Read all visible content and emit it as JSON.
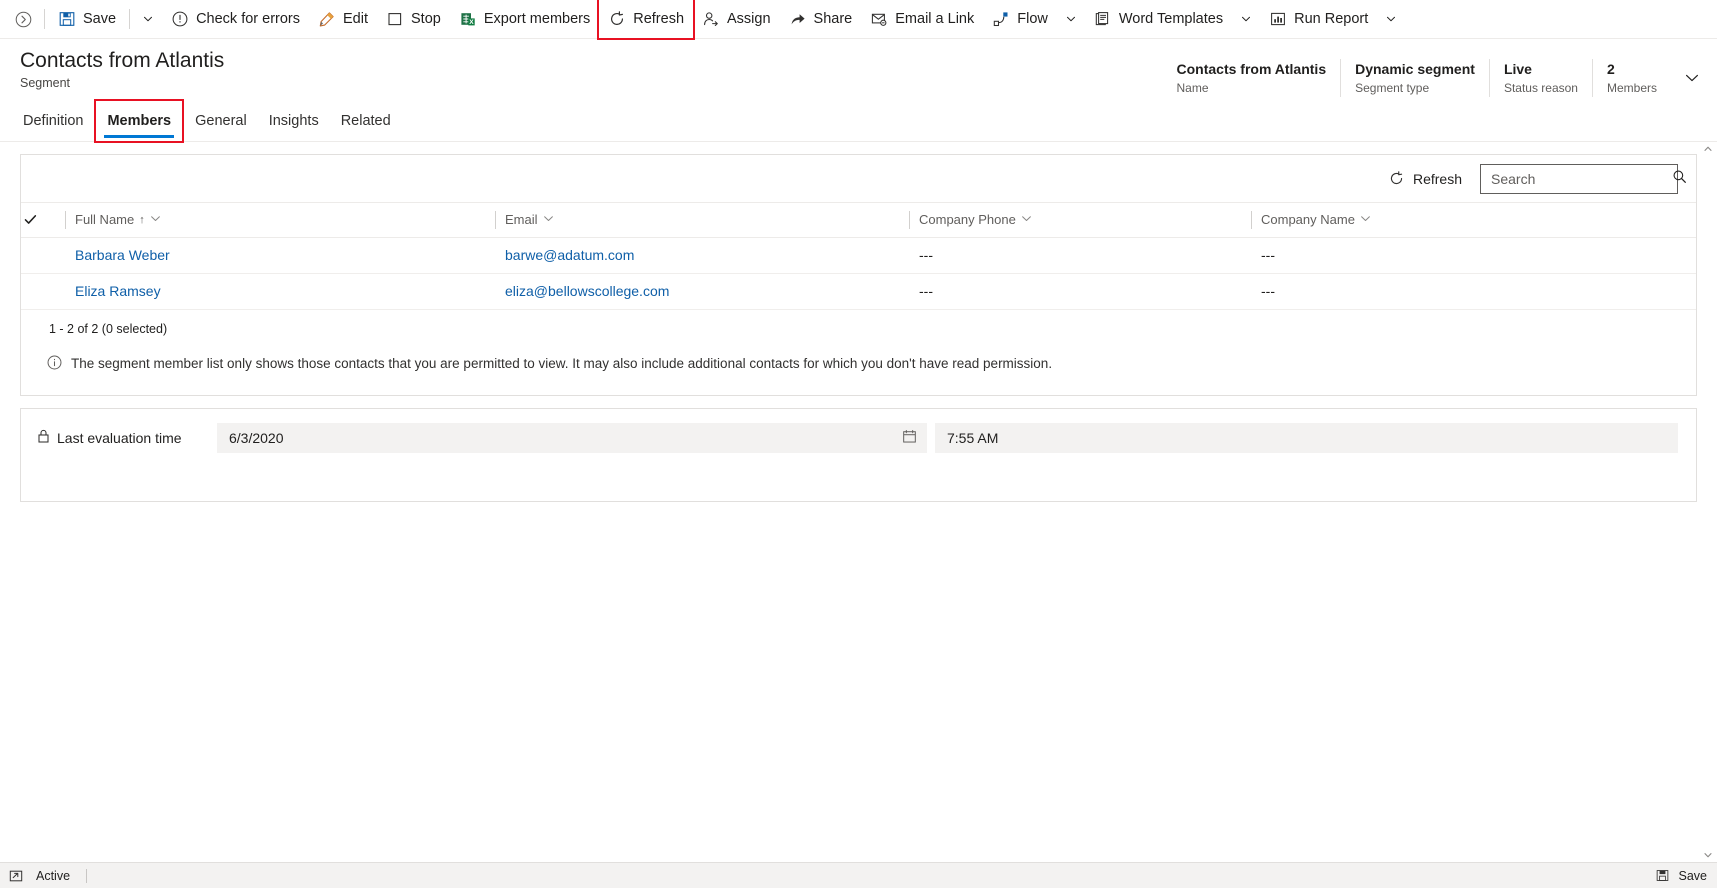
{
  "commandbar": {
    "expand_icon": "chevron-right-circle-icon",
    "items": [
      {
        "id": "save",
        "label": "Save",
        "icon": "save-icon",
        "caret": true
      },
      {
        "id": "check-for-errors",
        "label": "Check for errors",
        "icon": "error-circle-icon",
        "caret": false
      },
      {
        "id": "edit",
        "label": "Edit",
        "icon": "pencil-icon",
        "caret": false
      },
      {
        "id": "stop",
        "label": "Stop",
        "icon": "stop-square-icon",
        "caret": false
      },
      {
        "id": "export-members",
        "label": "Export members",
        "icon": "excel-icon",
        "caret": false
      },
      {
        "id": "refresh",
        "label": "Refresh",
        "icon": "refresh-icon",
        "caret": false,
        "highlighted": true
      },
      {
        "id": "assign",
        "label": "Assign",
        "icon": "assign-person-icon",
        "caret": false
      },
      {
        "id": "share",
        "label": "Share",
        "icon": "share-icon",
        "caret": false
      },
      {
        "id": "email-a-link",
        "label": "Email a Link",
        "icon": "email-link-icon",
        "caret": false
      },
      {
        "id": "flow",
        "label": "Flow",
        "icon": "flow-icon",
        "caret": true
      },
      {
        "id": "word-templates",
        "label": "Word Templates",
        "icon": "word-template-icon",
        "caret": true
      },
      {
        "id": "run-report",
        "label": "Run Report",
        "icon": "report-icon",
        "caret": true
      }
    ]
  },
  "title": {
    "name": "Contacts from Atlantis",
    "entity": "Segment"
  },
  "header_fields": [
    {
      "value": "Contacts from Atlantis",
      "label": "Name"
    },
    {
      "value": "Dynamic segment",
      "label": "Segment type"
    },
    {
      "value": "Live",
      "label": "Status reason"
    },
    {
      "value": "2",
      "label": "Members"
    }
  ],
  "header_collapse_icon": "chevron-down-icon",
  "tabs": [
    {
      "id": "definition",
      "label": "Definition",
      "active": false,
      "highlighted": false
    },
    {
      "id": "members",
      "label": "Members",
      "active": true,
      "highlighted": true
    },
    {
      "id": "general",
      "label": "General",
      "active": false,
      "highlighted": false
    },
    {
      "id": "insights",
      "label": "Insights",
      "active": false,
      "highlighted": false
    },
    {
      "id": "related",
      "label": "Related",
      "active": false,
      "highlighted": false
    }
  ],
  "grid": {
    "refresh_label": "Refresh",
    "refresh_icon": "refresh-icon",
    "search_placeholder": "Search",
    "search_value": "",
    "search_icon": "search-icon",
    "columns": [
      {
        "label": "Full Name",
        "sorted": true,
        "sort_dir": "ascending",
        "sort_glyph": "↑"
      },
      {
        "label": "Email",
        "sorted": false,
        "sort_dir": "",
        "sort_glyph": ""
      },
      {
        "label": "Company Phone",
        "sorted": false,
        "sort_dir": "",
        "sort_glyph": ""
      },
      {
        "label": "Company Name",
        "sorted": false,
        "sort_dir": "",
        "sort_glyph": ""
      }
    ],
    "rows": [
      {
        "full_name": "Barbara Weber",
        "email": "barwe@adatum.com",
        "company_phone": "---",
        "company_name": "---"
      },
      {
        "full_name": "Eliza Ramsey",
        "email": "eliza@bellowscollege.com",
        "company_phone": "---",
        "company_name": "---"
      }
    ],
    "pager_text": "1 - 2 of 2 (0 selected)",
    "notice_icon": "info-circle-icon",
    "notice_text": "The segment member list only shows those contacts that you are permitted to view. It may also include additional contacts for which you don't have read permission."
  },
  "evaluation": {
    "lock_icon": "lock-icon",
    "label": "Last evaluation time",
    "date_value": "6/3/2020",
    "date_icon": "calendar-icon",
    "time_value": "7:55 AM"
  },
  "footer": {
    "left_icon": "popout-icon",
    "status": "Active",
    "save_label": "Save",
    "save_icon": "save-icon"
  },
  "colors": {
    "accent": "#0078d4",
    "link": "#0f5fa8",
    "highlight": "#e81123",
    "text": "#201f1e",
    "muted": "#605e5c",
    "border": "#e1dfdd",
    "footer_bg": "#f3f2f1"
  }
}
